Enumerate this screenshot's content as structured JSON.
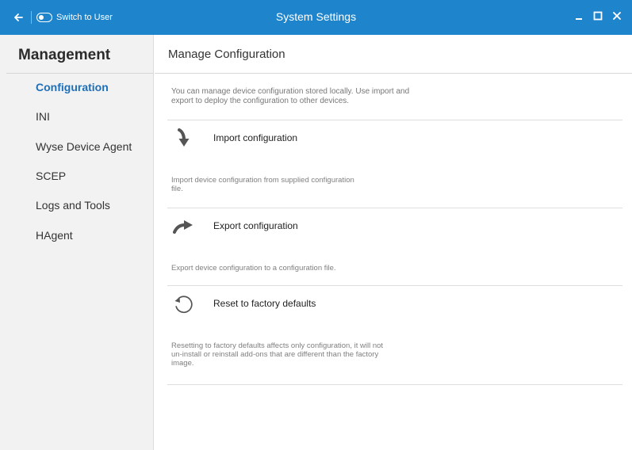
{
  "titlebar": {
    "title": "System Settings",
    "switch_label": "Switch to User"
  },
  "sidebar": {
    "heading": "Management",
    "items": [
      {
        "label": "Configuration",
        "active": true
      },
      {
        "label": "INI"
      },
      {
        "label": "Wyse Device Agent"
      },
      {
        "label": "SCEP"
      },
      {
        "label": "Logs and Tools"
      },
      {
        "label": "HAgent"
      }
    ]
  },
  "main": {
    "title": "Manage Configuration",
    "intro": "You can manage device configuration stored locally. Use import and export to deploy the configuration to other devices.",
    "actions": [
      {
        "label": "Import configuration",
        "icon": "import-arrow-icon",
        "description": "Import device configuration from supplied configuration file."
      },
      {
        "label": "Export configuration",
        "icon": "export-arrow-icon",
        "description": "Export device configuration to a configuration file."
      },
      {
        "label": "Reset to factory defaults",
        "icon": "reset-icon",
        "description": "Resetting to factory defaults affects only configuration, it will not un-install or reinstall add-ons that are different than the factory image."
      }
    ]
  },
  "colors": {
    "titlebar": "#1e84cc",
    "active_nav": "#1e6fb8",
    "sidebar_bg": "#f2f2f2"
  }
}
